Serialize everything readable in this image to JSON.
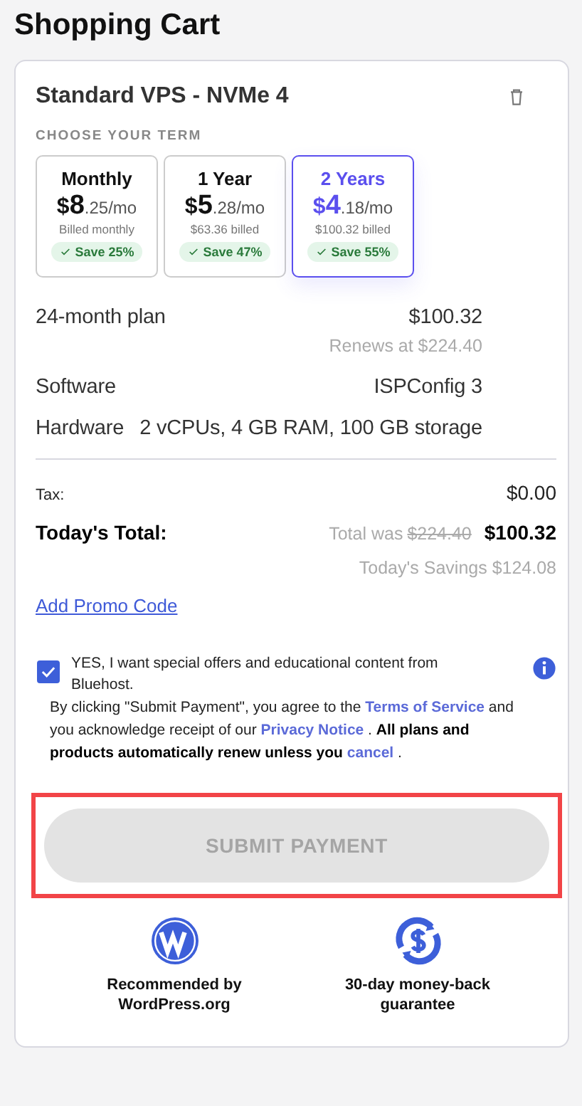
{
  "page_title": "Shopping Cart",
  "product": {
    "name": "Standard VPS - NVMe 4",
    "term_label": "CHOOSE YOUR TERM"
  },
  "terms": [
    {
      "label": "Monthly",
      "currency": "$",
      "price_main": "8",
      "price_rest": ".25/mo",
      "billed": "Billed monthly",
      "save": "Save 25%",
      "selected": false
    },
    {
      "label": "1 Year",
      "currency": "$",
      "price_main": "5",
      "price_rest": ".28/mo",
      "billed": "$63.36 billed",
      "save": "Save 47%",
      "selected": false
    },
    {
      "label": "2 Years",
      "currency": "$",
      "price_main": "4",
      "price_rest": ".18/mo",
      "billed": "$100.32 billed",
      "save": "Save 55%",
      "selected": true
    }
  ],
  "details": [
    {
      "label": "24-month plan",
      "value": "$100.32",
      "note": "Renews at $224.40"
    },
    {
      "label": "Software",
      "value": "ISPConfig 3"
    },
    {
      "label": "Hardware",
      "value": "2 vCPUs, 4 GB RAM, 100 GB storage"
    }
  ],
  "tax": {
    "label": "Tax:",
    "value": "$0.00"
  },
  "total": {
    "label": "Today's Total:",
    "was_label": "Total was",
    "was_value": "$224.40",
    "value": "$100.32",
    "savings": "Today's Savings $124.08"
  },
  "promo_link": "Add Promo Code",
  "offers": {
    "checked": true,
    "text": "YES, I want special offers and educational content from Bluehost."
  },
  "disclaimer": [
    {
      "kind": "plain",
      "text": "By clicking \"Submit Payment\", you agree to the "
    },
    {
      "kind": "link",
      "text": "Terms of Service"
    },
    {
      "kind": "plain",
      "text": " and you acknowledge receipt of our "
    },
    {
      "kind": "link",
      "text": "Privacy Notice"
    },
    {
      "kind": "plain",
      "text": " . "
    },
    {
      "kind": "bold",
      "text": "All plans and products automatically renew unless you "
    },
    {
      "kind": "link",
      "text": "cancel"
    },
    {
      "kind": "plain",
      "text": " ."
    }
  ],
  "submit": {
    "label": "SUBMIT PAYMENT",
    "disabled": true,
    "highlighted": true
  },
  "badges": [
    {
      "kind": "wordpress",
      "text": "Recommended by WordPress.org"
    },
    {
      "kind": "moneyback",
      "text": "30-day money-back guarantee"
    }
  ]
}
